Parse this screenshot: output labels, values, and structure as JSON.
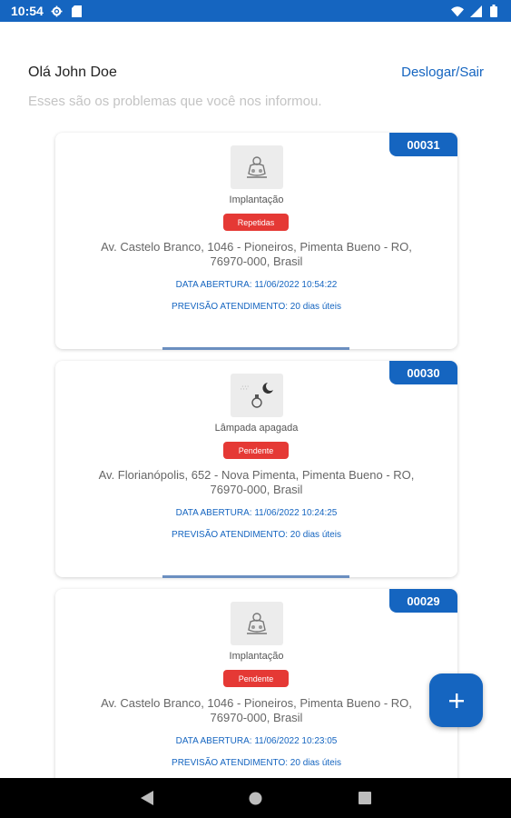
{
  "status_bar": {
    "time": "10:54",
    "icons": [
      "settings-icon",
      "sim-card-icon",
      "wifi-icon",
      "signal-icon",
      "battery-icon"
    ]
  },
  "header": {
    "greeting": "Olá John Doe",
    "logout_label": "Deslogar/Sair",
    "subtitle": "Esses são os problemas que você nos informou."
  },
  "reports": [
    {
      "id": "00031",
      "category": "Implantação",
      "status": "Repetidas",
      "address": "Av. Castelo Branco, 1046 - Pioneiros, Pimenta Bueno - RO, 76970-000, Brasil",
      "opened": "DATA ABERTURA: 11/06/2022 10:54:22",
      "forecast": "PREVISÃO ATENDIMENTO: 20 dias úteis",
      "icon": "implantation-icon"
    },
    {
      "id": "00030",
      "category": "Lâmpada apagada",
      "status": "Pendente",
      "address": "Av. Florianópolis, 652 - Nova Pimenta, Pimenta Bueno - RO, 76970-000, Brasil",
      "opened": "DATA ABERTURA: 11/06/2022 10:24:25",
      "forecast": "PREVISÃO ATENDIMENTO: 20 dias úteis",
      "icon": "lamp-off-icon"
    },
    {
      "id": "00029",
      "category": "Implantação",
      "status": "Pendente",
      "address": "Av. Castelo Branco, 1046 - Pioneiros, Pimenta Bueno - RO, 76970-000, Brasil",
      "opened": "DATA ABERTURA: 11/06/2022 10:23:05",
      "forecast": "PREVISÃO ATENDIMENTO: 20 dias úteis",
      "icon": "implantation-icon"
    }
  ],
  "fab": {
    "label": "+",
    "icon": "add-icon"
  },
  "nav_bar": {
    "icons": [
      "back-icon",
      "home-icon",
      "recents-icon"
    ]
  },
  "colors": {
    "primary": "#1565c0",
    "status_red": "#e53935",
    "muted_text": "#c4c4c4"
  }
}
